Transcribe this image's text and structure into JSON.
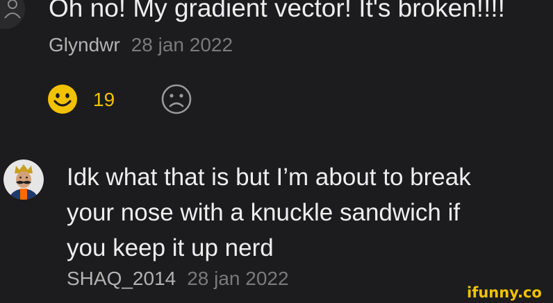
{
  "comment": {
    "title": "Oh no! My gradient vector! It's broken!!!!",
    "author": "Glyndwr",
    "date": "28 jan 2022",
    "avatar_icon": "user-outline-icon"
  },
  "reactions": {
    "like_icon": "smiley-face-icon",
    "like_count": "19",
    "dislike_icon": "sad-face-icon",
    "like_color": "#f2c200"
  },
  "reply": {
    "lines": [
      "Idk what that is but I’m about to break",
      "your nose with a knuckle sandwich if",
      "you keep it up nerd"
    ],
    "author": "SHAQ_2014",
    "date": "28 jan 2022",
    "avatar_icon": "crowned-mustache-avatar"
  },
  "watermark": {
    "text": "ifunny.co"
  }
}
